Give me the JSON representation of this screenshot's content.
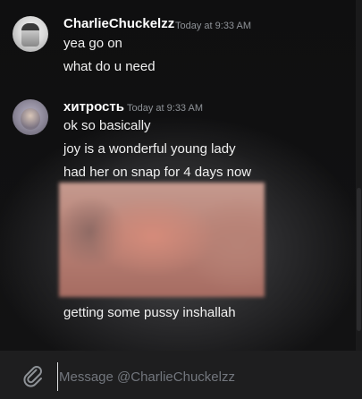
{
  "messages": [
    {
      "author": "CharlieChuckelzz",
      "timestamp": "Today at 9:33 AM",
      "avatar_icon": "user-avatar-icon",
      "lines": [
        "yea go on",
        "what do u need"
      ]
    },
    {
      "author": "хитрость",
      "timestamp": "Today at 9:33 AM",
      "avatar_icon": "user-avatar-icon",
      "lines": [
        "ok so basically",
        "joy is a wonderful young lady",
        "had her on snap for 4 days now"
      ],
      "attachment": "blurred-image",
      "after_attachment": "getting some pussy inshallah"
    }
  ],
  "composer": {
    "placeholder": "Message @CharlieChuckelzz",
    "attach_icon": "paperclip-icon"
  },
  "colors": {
    "background": "#0c0c0d",
    "username": "#ffffff",
    "timestamp": "#8e9297",
    "text": "#f0f0f0",
    "composer_bg": "#1e1e1f"
  }
}
